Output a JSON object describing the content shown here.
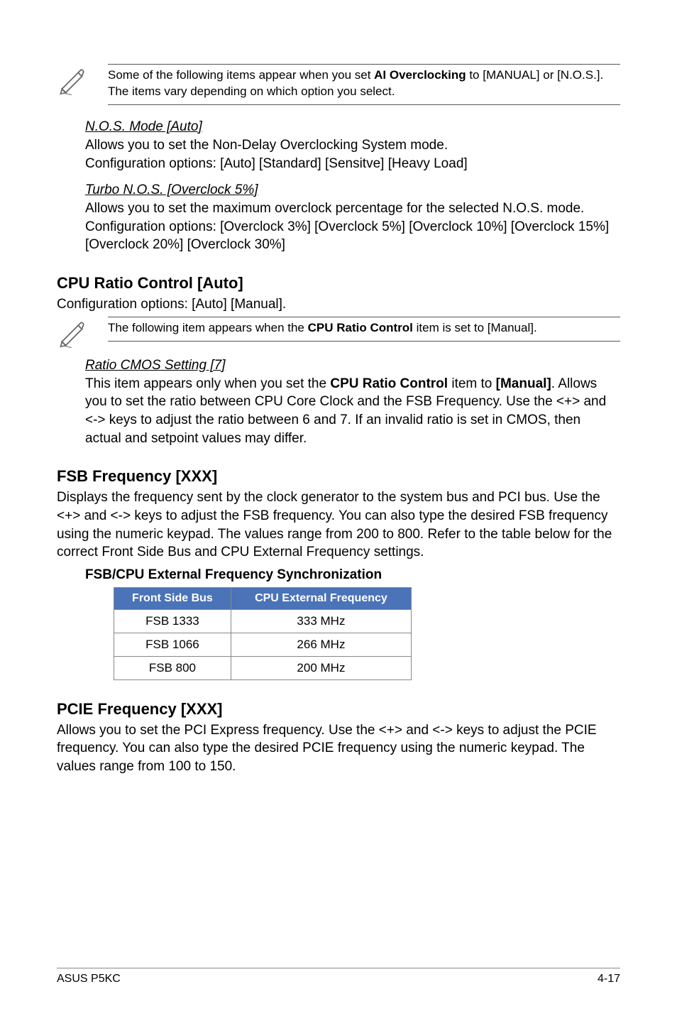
{
  "note1": {
    "text_a": "Some of the following items appear when you set ",
    "bold": "AI Overclocking",
    "text_b": " to [MANUAL] or [N.O.S.]. The items vary depending on which option you select."
  },
  "nos_mode": {
    "heading": "N.O.S. Mode [Auto]",
    "line1": "Allows you to set the Non-Delay Overclocking System mode.",
    "line2": "Configuration options: [Auto] [Standard] [Sensitve] [Heavy Load]"
  },
  "turbo": {
    "heading": "Turbo N.O.S. [Overclock 5%]",
    "body": "Allows you to set the maximum overclock percentage for the selected N.O.S. mode. Configuration options: [Overclock 3%] [Overclock 5%] [Overclock 10%] [Overclock 15%] [Overclock 20%] [Overclock 30%]"
  },
  "cpu_ratio": {
    "heading": "CPU Ratio Control [Auto]",
    "body": "Configuration options: [Auto] [Manual]."
  },
  "note2": {
    "text_a": "The following item appears when the ",
    "bold": "CPU Ratio Control",
    "text_b": " item is set to [Manual]."
  },
  "ratio_cmos": {
    "heading": "Ratio CMOS Setting [7]",
    "t1": "This item appears only when you set the ",
    "b1": "CPU Ratio Control",
    "t2": " item to ",
    "b2": "[Manual]",
    "t3": ". Allows you to set the ratio between CPU Core Clock and the FSB Frequency. Use the <+> and <-> keys to adjust the ratio between 6 and 7. If an invalid ratio is set in CMOS, then actual and setpoint values may differ."
  },
  "fsb_freq": {
    "heading": "FSB Frequency [XXX]",
    "body": "Displays the frequency sent by the clock generator to the system bus and PCI bus. Use the <+> and <-> keys to adjust the FSB frequency. You can also type the desired FSB frequency using the numeric keypad. The values range from 200 to 800. Refer to the table below for the correct Front Side Bus and CPU External Frequency settings."
  },
  "table": {
    "title": "FSB/CPU External Frequency Synchronization",
    "headers": [
      "Front Side Bus",
      "CPU External Frequency"
    ],
    "rows": [
      [
        "FSB 1333",
        "333 MHz"
      ],
      [
        "FSB 1066",
        "266 MHz"
      ],
      [
        "FSB 800",
        "200 MHz"
      ]
    ]
  },
  "pcie": {
    "heading": "PCIE Frequency [XXX]",
    "body": "Allows you to set the PCI Express frequency. Use the <+> and <-> keys to adjust the PCIE frequency. You can also type the desired PCIE frequency using the numeric keypad. The values range from 100 to 150."
  },
  "footer": {
    "left": "ASUS P5KC",
    "right": "4-17"
  }
}
